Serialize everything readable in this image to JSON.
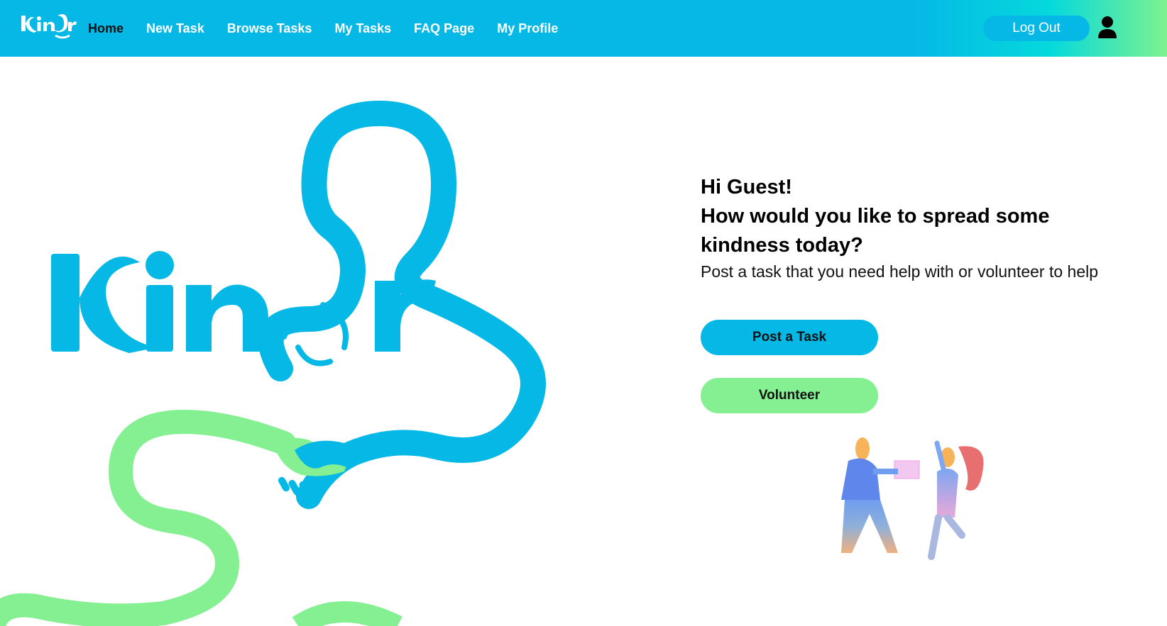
{
  "app": {
    "name": "Kindr"
  },
  "nav": {
    "items": [
      {
        "label": "Home",
        "active": true
      },
      {
        "label": "New Task",
        "active": false
      },
      {
        "label": "Browse Tasks",
        "active": false
      },
      {
        "label": "My Tasks",
        "active": false
      },
      {
        "label": "FAQ Page",
        "active": false
      },
      {
        "label": "My Profile",
        "active": false
      }
    ],
    "logout_label": "Log Out",
    "user_icon": "user-icon"
  },
  "hero": {
    "greeting_line1": "Hi Guest!",
    "greeting_line2": "How would you like to spread some kindness today?",
    "subtitle": "Post a task that you need help with or volunteer to help",
    "post_button": "Post a Task",
    "volunteer_button": "Volunteer"
  },
  "colors": {
    "primary_blue": "#05b8e6",
    "accent_green": "#84f091",
    "nav_active": "#111111"
  }
}
